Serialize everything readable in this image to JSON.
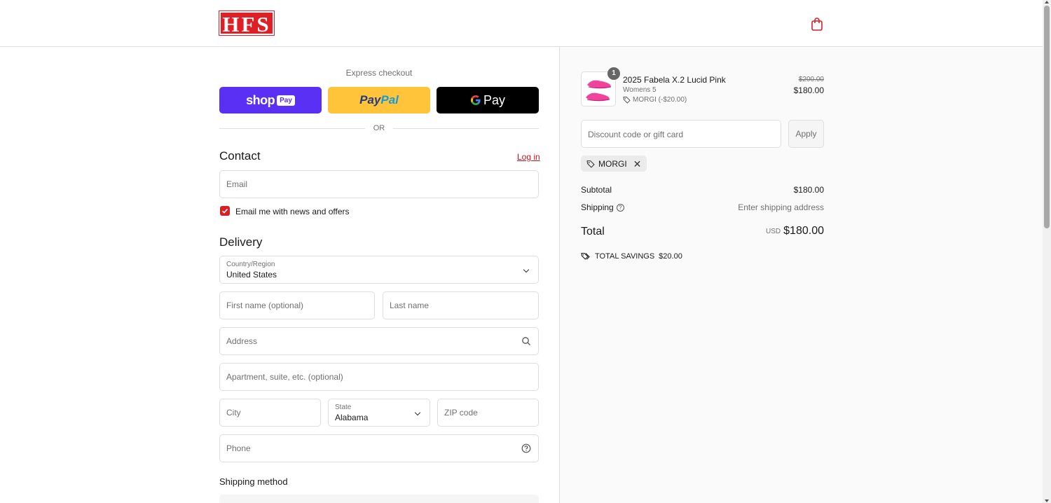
{
  "brand": {
    "logo_text": "HFS",
    "accent": "#e01e25"
  },
  "header": {
    "cart_icon": "shopping-bag-icon"
  },
  "express": {
    "title": "Express checkout",
    "shop_pay": {
      "word": "shop",
      "badge": "Pay"
    },
    "paypal": {
      "part1": "Pay",
      "part2": "Pal"
    },
    "gpay": {
      "g": "G",
      "word": "Pay"
    },
    "or": "OR"
  },
  "contact": {
    "title": "Contact",
    "login": "Log in",
    "email_placeholder": "Email",
    "newsletter_label": "Email me with news and offers",
    "newsletter_checked": true
  },
  "delivery": {
    "title": "Delivery",
    "country_label": "Country/Region",
    "country_value": "United States",
    "first_name_placeholder": "First name (optional)",
    "last_name_placeholder": "Last name",
    "address_placeholder": "Address",
    "apartment_placeholder": "Apartment, suite, etc. (optional)",
    "city_placeholder": "City",
    "state_label": "State",
    "state_value": "Alabama",
    "zip_placeholder": "ZIP code",
    "phone_placeholder": "Phone"
  },
  "shipping_method": {
    "title": "Shipping method"
  },
  "summary": {
    "product": {
      "quantity": "1",
      "name": "2025 Fabela X.2 Lucid Pink",
      "variant": "Womens 5",
      "discount": "MORGI (-$20.00)",
      "old_price": "$200.00",
      "price": "$180.00"
    },
    "discount_placeholder": "Discount code or gift card",
    "apply_label": "Apply",
    "applied_code": "MORGI",
    "subtotal_label": "Subtotal",
    "subtotal_value": "$180.00",
    "shipping_label": "Shipping",
    "shipping_value": "Enter shipping address",
    "total_label": "Total",
    "total_currency": "USD",
    "total_value": "$180.00",
    "savings_label": "TOTAL SAVINGS",
    "savings_value": "$20.00"
  }
}
